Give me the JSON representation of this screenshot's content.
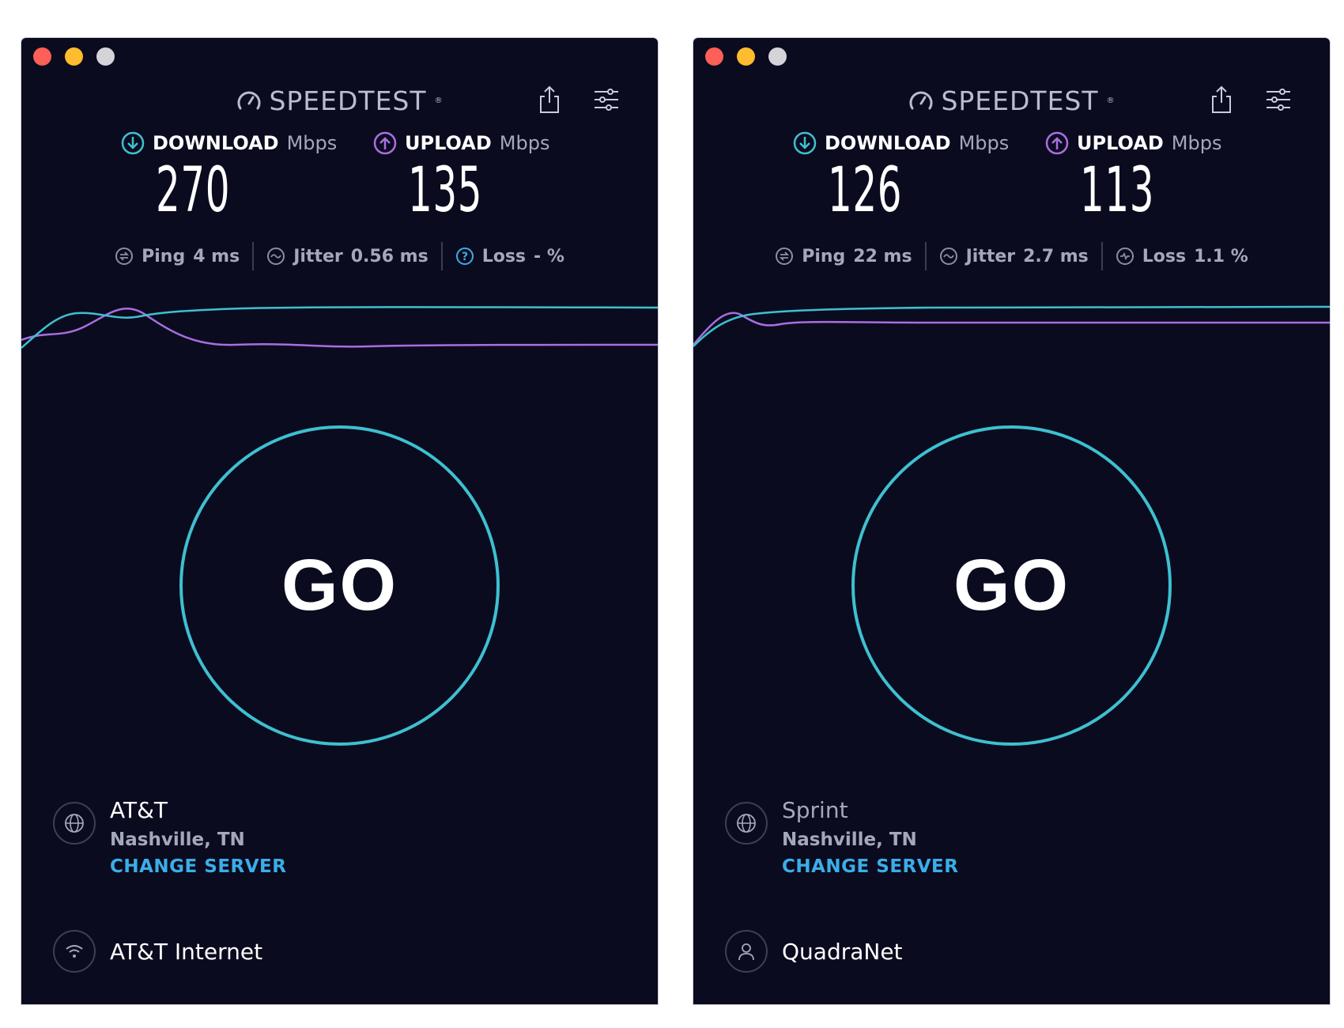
{
  "brand": {
    "name": "SPEEDTEST",
    "trademark": "®"
  },
  "colors": {
    "background": "#0b0b1f",
    "download": "#3ec0d0",
    "upload": "#a86ee0",
    "accent_link": "#3aaee8"
  },
  "panels": [
    {
      "download": {
        "label": "DOWNLOAD",
        "unit": "Mbps",
        "value": "270"
      },
      "upload": {
        "label": "UPLOAD",
        "unit": "Mbps",
        "value": "135"
      },
      "ping": {
        "label": "Ping",
        "value": "4 ms"
      },
      "jitter": {
        "label": "Jitter",
        "value": "0.56 ms"
      },
      "loss": {
        "label": "Loss",
        "value": "- %",
        "icon": "question-circle-icon"
      },
      "go_label": "GO",
      "server": {
        "name": "AT&T",
        "location": "Nashville, TN",
        "change_label": "CHANGE SERVER"
      },
      "isp": {
        "name": "AT&T Internet",
        "icon": "wifi-icon"
      }
    },
    {
      "download": {
        "label": "DOWNLOAD",
        "unit": "Mbps",
        "value": "126"
      },
      "upload": {
        "label": "UPLOAD",
        "unit": "Mbps",
        "value": "113"
      },
      "ping": {
        "label": "Ping",
        "value": "22 ms"
      },
      "jitter": {
        "label": "Jitter",
        "value": "2.7 ms"
      },
      "loss": {
        "label": "Loss",
        "value": "1.1 %",
        "icon": "loss-icon"
      },
      "go_label": "GO",
      "server": {
        "name": "Sprint",
        "location": "Nashville, TN",
        "change_label": "CHANGE SERVER"
      },
      "isp": {
        "name": "QuadraNet",
        "icon": "user-icon"
      }
    }
  ]
}
